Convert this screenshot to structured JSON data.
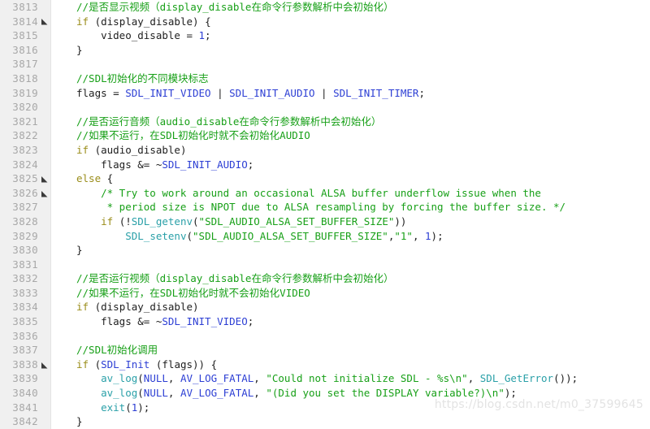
{
  "editor": {
    "first_line_number": 3813,
    "last_line_number": 3842,
    "line_count": 30,
    "colors": {
      "background": "#ffffff",
      "gutter_background": "#f0f0f0",
      "line_number": "#a8a8a8",
      "comment": "#18a018",
      "keyword": "#9a8d1a",
      "identifier": "#2d3fd4",
      "function": "#2aa0a8",
      "string": "#18a018",
      "number": "#2d3fd4",
      "plain_text": "#202020",
      "watermark": "#e3e3e3"
    }
  },
  "watermark": {
    "text": "https://blog.csdn.net/m0_37599645"
  },
  "lines": [
    {
      "number": "3813",
      "fold": false,
      "tokens": [
        {
          "t": "comment",
          "v": "//",
          "cjk": false
        },
        {
          "t": "comment",
          "v": "是否显示视频（",
          "cjk": true
        },
        {
          "t": "comment",
          "v": "display_disable",
          "cjk": false
        },
        {
          "t": "comment",
          "v": "在命令行参数解析中会初始化）",
          "cjk": true
        }
      ]
    },
    {
      "number": "3814",
      "fold": true,
      "tokens": [
        {
          "t": "keyword",
          "v": "if",
          "cjk": false
        },
        {
          "t": "plain",
          "v": " (",
          "cjk": false
        },
        {
          "t": "plain",
          "v": "display_disable",
          "cjk": false
        },
        {
          "t": "plain",
          "v": ") {",
          "cjk": false
        }
      ]
    },
    {
      "number": "3815",
      "fold": false,
      "tokens": [
        {
          "t": "plain",
          "v": "    video_disable = ",
          "cjk": false
        },
        {
          "t": "number",
          "v": "1",
          "cjk": false
        },
        {
          "t": "plain",
          "v": ";",
          "cjk": false
        }
      ]
    },
    {
      "number": "3816",
      "fold": false,
      "tokens": [
        {
          "t": "plain",
          "v": "}",
          "cjk": false
        }
      ]
    },
    {
      "number": "3817",
      "fold": false,
      "tokens": []
    },
    {
      "number": "3818",
      "fold": false,
      "tokens": [
        {
          "t": "comment",
          "v": "//SDL",
          "cjk": false
        },
        {
          "t": "comment",
          "v": "初始化的不同模块标志",
          "cjk": true
        }
      ]
    },
    {
      "number": "3819",
      "fold": false,
      "tokens": [
        {
          "t": "plain",
          "v": "flags = ",
          "cjk": false
        },
        {
          "t": "ident",
          "v": "SDL_INIT_VIDEO",
          "cjk": false
        },
        {
          "t": "plain",
          "v": " | ",
          "cjk": false
        },
        {
          "t": "ident",
          "v": "SDL_INIT_AUDIO",
          "cjk": false
        },
        {
          "t": "plain",
          "v": " | ",
          "cjk": false
        },
        {
          "t": "ident",
          "v": "SDL_INIT_TIMER",
          "cjk": false
        },
        {
          "t": "plain",
          "v": ";",
          "cjk": false
        }
      ]
    },
    {
      "number": "3820",
      "fold": false,
      "tokens": []
    },
    {
      "number": "3821",
      "fold": false,
      "tokens": [
        {
          "t": "comment",
          "v": "//",
          "cjk": false
        },
        {
          "t": "comment",
          "v": "是否运行音频（",
          "cjk": true
        },
        {
          "t": "comment",
          "v": "audio_disable",
          "cjk": false
        },
        {
          "t": "comment",
          "v": "在命令行参数解析中会初始化）",
          "cjk": true
        }
      ]
    },
    {
      "number": "3822",
      "fold": false,
      "tokens": [
        {
          "t": "comment",
          "v": "//",
          "cjk": false
        },
        {
          "t": "comment",
          "v": "如果不运行，在",
          "cjk": true
        },
        {
          "t": "comment",
          "v": "SDL",
          "cjk": false
        },
        {
          "t": "comment",
          "v": "初始化时就不会初始化",
          "cjk": true
        },
        {
          "t": "comment",
          "v": "AUDIO",
          "cjk": false
        }
      ]
    },
    {
      "number": "3823",
      "fold": false,
      "tokens": [
        {
          "t": "keyword",
          "v": "if",
          "cjk": false
        },
        {
          "t": "plain",
          "v": " (audio_disable)",
          "cjk": false
        }
      ]
    },
    {
      "number": "3824",
      "fold": false,
      "tokens": [
        {
          "t": "plain",
          "v": "    flags &= ~",
          "cjk": false
        },
        {
          "t": "ident",
          "v": "SDL_INIT_AUDIO",
          "cjk": false
        },
        {
          "t": "plain",
          "v": ";",
          "cjk": false
        }
      ]
    },
    {
      "number": "3825",
      "fold": true,
      "tokens": [
        {
          "t": "keyword",
          "v": "else",
          "cjk": false
        },
        {
          "t": "plain",
          "v": " {",
          "cjk": false
        }
      ]
    },
    {
      "number": "3826",
      "fold": true,
      "tokens": [
        {
          "t": "comment",
          "v": "    /* Try to work around an occasional ALSA buffer underflow issue when the",
          "cjk": false
        }
      ]
    },
    {
      "number": "3827",
      "fold": false,
      "tokens": [
        {
          "t": "comment",
          "v": "     * period size is NPOT due to ALSA resampling by forcing the buffer size. */",
          "cjk": false
        }
      ]
    },
    {
      "number": "3828",
      "fold": false,
      "tokens": [
        {
          "t": "plain",
          "v": "    ",
          "cjk": false
        },
        {
          "t": "keyword",
          "v": "if",
          "cjk": false
        },
        {
          "t": "plain",
          "v": " (!",
          "cjk": false
        },
        {
          "t": "func",
          "v": "SDL_getenv",
          "cjk": false
        },
        {
          "t": "plain",
          "v": "(",
          "cjk": false
        },
        {
          "t": "string",
          "v": "\"SDL_AUDIO_ALSA_SET_BUFFER_SIZE\"",
          "cjk": false
        },
        {
          "t": "plain",
          "v": "))",
          "cjk": false
        }
      ]
    },
    {
      "number": "3829",
      "fold": false,
      "tokens": [
        {
          "t": "plain",
          "v": "        ",
          "cjk": false
        },
        {
          "t": "func",
          "v": "SDL_setenv",
          "cjk": false
        },
        {
          "t": "plain",
          "v": "(",
          "cjk": false
        },
        {
          "t": "string",
          "v": "\"SDL_AUDIO_ALSA_SET_BUFFER_SIZE\"",
          "cjk": false
        },
        {
          "t": "plain",
          "v": ",",
          "cjk": false
        },
        {
          "t": "string",
          "v": "\"1\"",
          "cjk": false
        },
        {
          "t": "plain",
          "v": ", ",
          "cjk": false
        },
        {
          "t": "number",
          "v": "1",
          "cjk": false
        },
        {
          "t": "plain",
          "v": ");",
          "cjk": false
        }
      ]
    },
    {
      "number": "3830",
      "fold": false,
      "tokens": [
        {
          "t": "plain",
          "v": "}",
          "cjk": false
        }
      ]
    },
    {
      "number": "3831",
      "fold": false,
      "tokens": []
    },
    {
      "number": "3832",
      "fold": false,
      "tokens": [
        {
          "t": "comment",
          "v": "//",
          "cjk": false
        },
        {
          "t": "comment",
          "v": "是否运行视频（",
          "cjk": true
        },
        {
          "t": "comment",
          "v": "display_disable",
          "cjk": false
        },
        {
          "t": "comment",
          "v": "在命令行参数解析中会初始化）",
          "cjk": true
        }
      ]
    },
    {
      "number": "3833",
      "fold": false,
      "tokens": [
        {
          "t": "comment",
          "v": "//",
          "cjk": false
        },
        {
          "t": "comment",
          "v": "如果不运行，在",
          "cjk": true
        },
        {
          "t": "comment",
          "v": "SDL",
          "cjk": false
        },
        {
          "t": "comment",
          "v": "初始化时就不会初始化",
          "cjk": true
        },
        {
          "t": "comment",
          "v": "VIDEO",
          "cjk": false
        }
      ]
    },
    {
      "number": "3834",
      "fold": false,
      "tokens": [
        {
          "t": "keyword",
          "v": "if",
          "cjk": false
        },
        {
          "t": "plain",
          "v": " (display_disable)",
          "cjk": false
        }
      ]
    },
    {
      "number": "3835",
      "fold": false,
      "tokens": [
        {
          "t": "plain",
          "v": "    flags &= ~",
          "cjk": false
        },
        {
          "t": "ident",
          "v": "SDL_INIT_VIDEO",
          "cjk": false
        },
        {
          "t": "plain",
          "v": ";",
          "cjk": false
        }
      ]
    },
    {
      "number": "3836",
      "fold": false,
      "tokens": []
    },
    {
      "number": "3837",
      "fold": false,
      "tokens": [
        {
          "t": "comment",
          "v": "//SDL",
          "cjk": false
        },
        {
          "t": "comment",
          "v": "初始化调用",
          "cjk": true
        }
      ]
    },
    {
      "number": "3838",
      "fold": true,
      "tokens": [
        {
          "t": "keyword",
          "v": "if",
          "cjk": false
        },
        {
          "t": "plain",
          "v": " (",
          "cjk": false
        },
        {
          "t": "ident",
          "v": "SDL_Init",
          "cjk": false
        },
        {
          "t": "plain",
          "v": " (flags)) {",
          "cjk": false
        }
      ]
    },
    {
      "number": "3839",
      "fold": false,
      "tokens": [
        {
          "t": "plain",
          "v": "    ",
          "cjk": false
        },
        {
          "t": "func",
          "v": "av_log",
          "cjk": false
        },
        {
          "t": "plain",
          "v": "(",
          "cjk": false
        },
        {
          "t": "ident",
          "v": "NULL",
          "cjk": false
        },
        {
          "t": "plain",
          "v": ", ",
          "cjk": false
        },
        {
          "t": "ident",
          "v": "AV_LOG_FATAL",
          "cjk": false
        },
        {
          "t": "plain",
          "v": ", ",
          "cjk": false
        },
        {
          "t": "string",
          "v": "\"Could not initialize SDL - %s\\n\"",
          "cjk": false
        },
        {
          "t": "plain",
          "v": ", ",
          "cjk": false
        },
        {
          "t": "func",
          "v": "SDL_GetError",
          "cjk": false
        },
        {
          "t": "plain",
          "v": "());",
          "cjk": false
        }
      ]
    },
    {
      "number": "3840",
      "fold": false,
      "tokens": [
        {
          "t": "plain",
          "v": "    ",
          "cjk": false
        },
        {
          "t": "func",
          "v": "av_log",
          "cjk": false
        },
        {
          "t": "plain",
          "v": "(",
          "cjk": false
        },
        {
          "t": "ident",
          "v": "NULL",
          "cjk": false
        },
        {
          "t": "plain",
          "v": ", ",
          "cjk": false
        },
        {
          "t": "ident",
          "v": "AV_LOG_FATAL",
          "cjk": false
        },
        {
          "t": "plain",
          "v": ", ",
          "cjk": false
        },
        {
          "t": "string",
          "v": "\"(Did you set the DISPLAY variable?)\\n\"",
          "cjk": false
        },
        {
          "t": "plain",
          "v": ");",
          "cjk": false
        }
      ]
    },
    {
      "number": "3841",
      "fold": false,
      "tokens": [
        {
          "t": "plain",
          "v": "    ",
          "cjk": false
        },
        {
          "t": "func",
          "v": "exit",
          "cjk": false
        },
        {
          "t": "plain",
          "v": "(",
          "cjk": false
        },
        {
          "t": "number",
          "v": "1",
          "cjk": false
        },
        {
          "t": "plain",
          "v": ");",
          "cjk": false
        }
      ]
    },
    {
      "number": "3842",
      "fold": false,
      "tokens": [
        {
          "t": "plain",
          "v": "}",
          "cjk": false
        }
      ]
    }
  ]
}
